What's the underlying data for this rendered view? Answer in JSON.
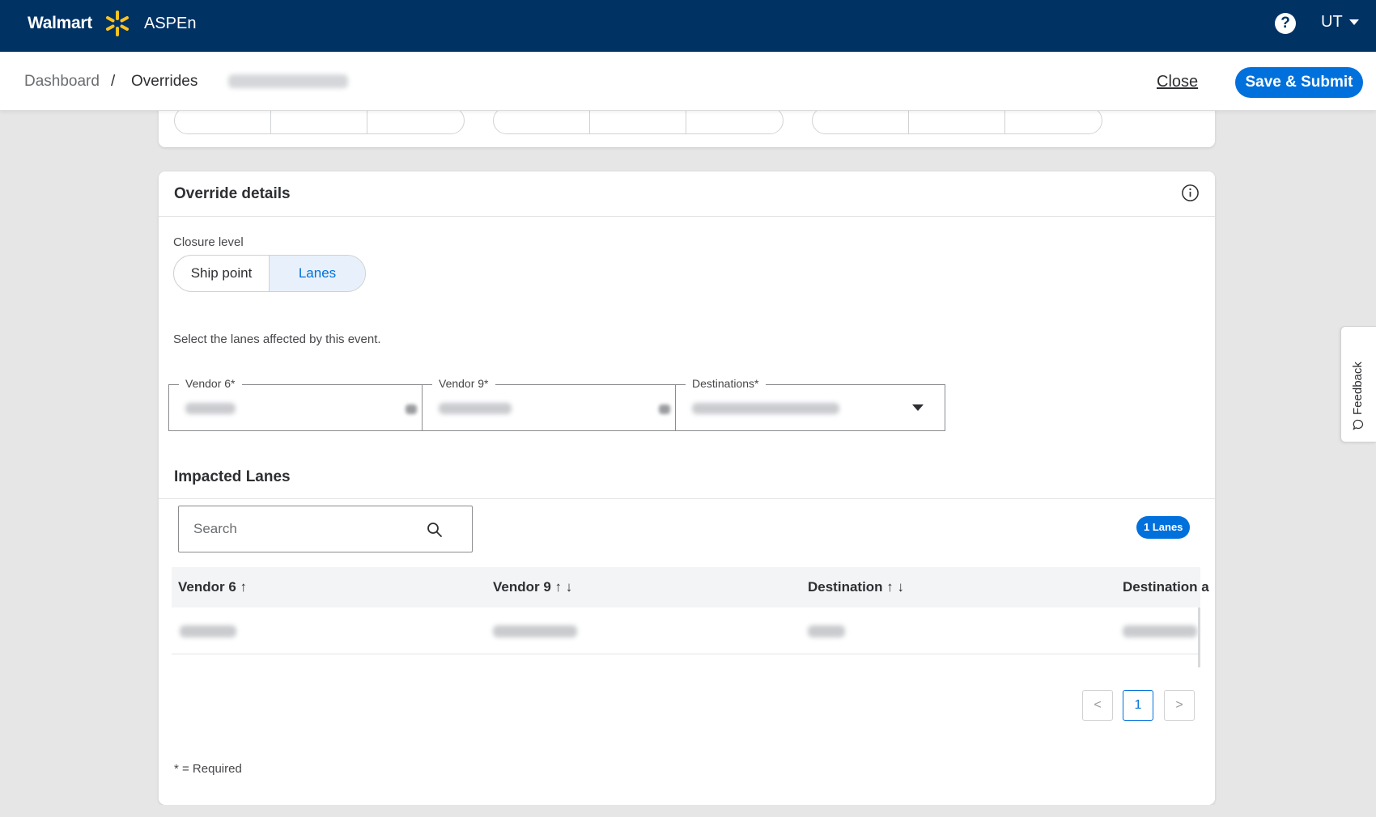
{
  "header": {
    "brand": "Walmart",
    "app_name": "ASPEn",
    "help_symbol": "?",
    "user_initials": "UT"
  },
  "subheader": {
    "breadcrumbs": [
      "Dashboard",
      "/",
      "Overrides"
    ],
    "close_label": "Close",
    "save_label": "Save & Submit"
  },
  "override_details": {
    "title": "Override details",
    "closure_level_label": "Closure level",
    "closure_options": [
      "Ship point",
      "Lanes"
    ],
    "selected_option": "Lanes",
    "lanes_instruction": "Select the lanes affected by this event.",
    "fields": [
      {
        "label": "Vendor 6*"
      },
      {
        "label": "Vendor 9*"
      },
      {
        "label": "Destinations*"
      }
    ]
  },
  "impacted_lanes": {
    "title": "Impacted Lanes",
    "search_placeholder": "Search",
    "count_badge": "1 Lanes",
    "columns": [
      "Vendor 6 ↑",
      "Vendor 9 ↑ ↓",
      "Destination ↑ ↓",
      "Destination a"
    ],
    "pagination": {
      "prev": "<",
      "current": "1",
      "next": ">"
    }
  },
  "footer_note": "* = Required",
  "feedback_label": "Feedback",
  "colors": {
    "topbar": "#003264",
    "primary": "#0071dc",
    "spark": "#ffc220",
    "highlight": "#8a2aa6"
  }
}
